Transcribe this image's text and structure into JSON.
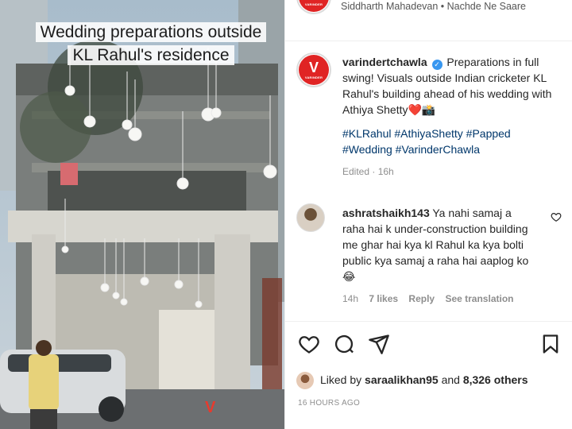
{
  "media": {
    "overlay_title": "Wedding preparations outside KL Rahul's residence"
  },
  "header": {
    "audio_text": "Siddharth Mahadevan • Nachde Ne Saare"
  },
  "post": {
    "avatar_letter": "V",
    "username": "varindertchawla",
    "caption": "Preparations in full swing! Visuals outside Indian cricketer KL Rahul's building ahead of his wedding with Athiya Shetty❤️📸",
    "hashtags": "#KLRahul #AthiyaShetty #Papped #Wedding #VarinderChawla",
    "edited": "Edited · 16h"
  },
  "comment": {
    "username": "ashratshaikh143",
    "text": "Ya nahi samaj a raha hai k under-construction building me ghar hai kya kl Rahul ka kya bolti public kya samaj a raha hai aaplog ko 😂",
    "time": "14h",
    "likes": "7 likes",
    "reply": "Reply",
    "translate": "See translation"
  },
  "actions": {
    "like_icon": "heart-icon",
    "comment_icon": "comment-icon",
    "share_icon": "share-icon",
    "save_icon": "bookmark-icon"
  },
  "likes": {
    "prefix": "Liked by",
    "user": "saraalikhan95",
    "joiner": "and",
    "others": "8,326 others"
  },
  "date": "16 HOURS AGO",
  "colors": {
    "link": "#00376b",
    "brand": "#e02424",
    "muted": "#8e8e8e",
    "verified": "#3897f0"
  }
}
